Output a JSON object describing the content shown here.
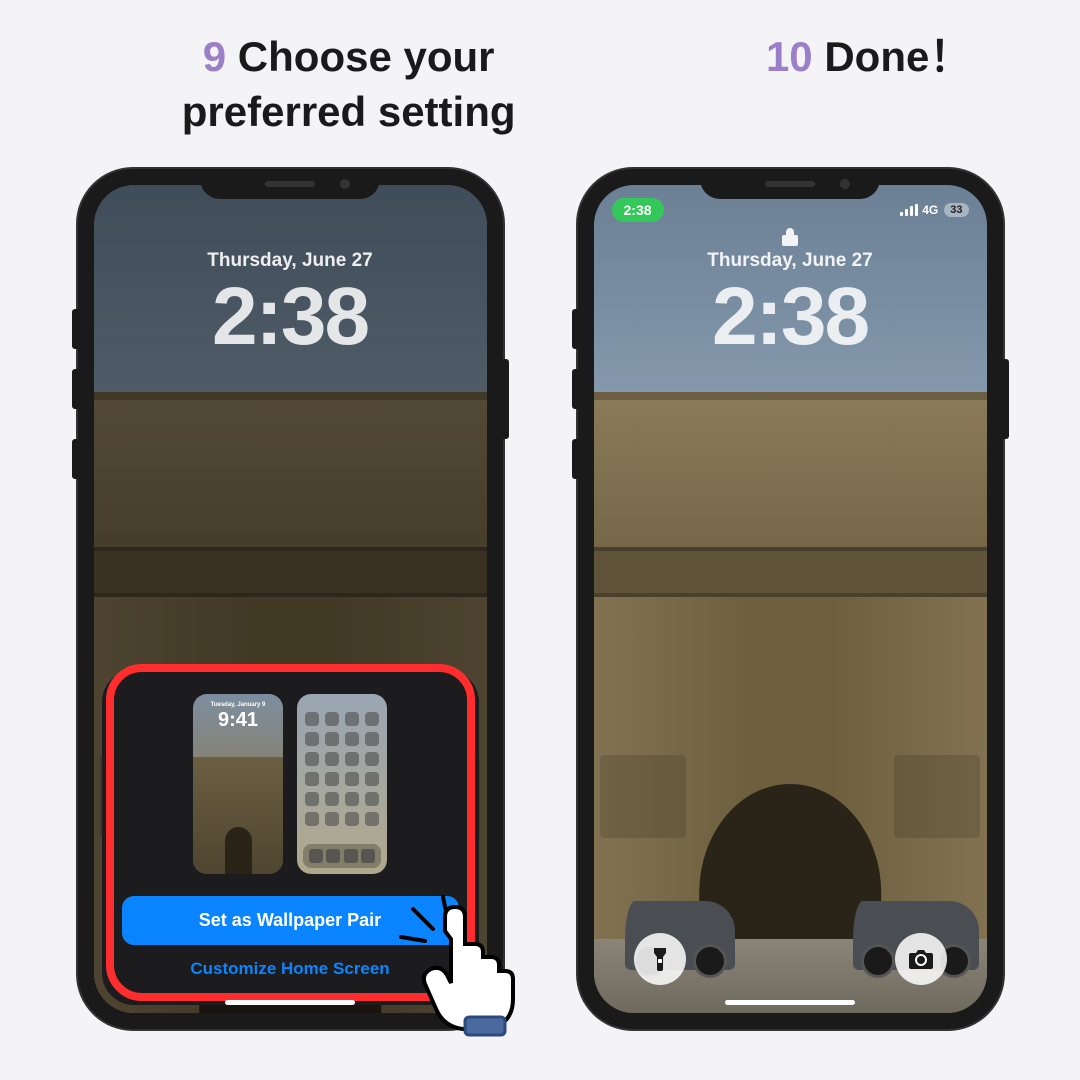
{
  "step9": {
    "number": "9",
    "title": "Choose your preferred setting"
  },
  "step10": {
    "number": "10",
    "title": "Done！"
  },
  "lockscreen": {
    "date": "Thursday, June 27",
    "time": "2:38"
  },
  "statusbar": {
    "time": "2:38",
    "network": "4G",
    "battery": "33"
  },
  "sheet": {
    "thumb_date": "Tuesday, January 9",
    "thumb_time": "9:41",
    "set_pair": "Set as Wallpaper Pair",
    "customize": "Customize Home Screen"
  },
  "icons": {
    "lock": "lock-icon",
    "flashlight": "flashlight-icon",
    "camera": "camera-icon",
    "signal": "signal-icon"
  }
}
